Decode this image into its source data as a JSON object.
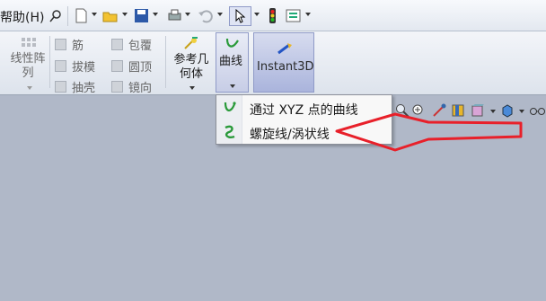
{
  "menubar": {
    "help_label": "帮助(H)",
    "icons": [
      "pin-icon",
      "new-document-icon",
      "open-folder-icon",
      "save-icon",
      "print-icon",
      "undo-icon",
      "select-pointer-icon",
      "traffic-light-icon",
      "options-icon"
    ]
  },
  "ribbon": {
    "linear_pattern": "线性阵列",
    "rib": "筋",
    "draft": "拔模",
    "shell": "抽壳",
    "wrap": "包覆",
    "dome": "圆顶",
    "mirror": "镜向",
    "ref_geometry": "参考几何体",
    "curves": "曲线",
    "instant3d": "Instant3D"
  },
  "dropdown": {
    "items": [
      {
        "label": "通过 XYZ 点的曲线",
        "icon": "curve-through-xyz-icon"
      },
      {
        "label": "螺旋线/涡状线",
        "icon": "helix-spiral-icon"
      }
    ]
  },
  "colors": {
    "canvas": "#b0b8c8",
    "annotation_arrow": "#e8202a",
    "ribbon_active": "#aab4dc"
  }
}
